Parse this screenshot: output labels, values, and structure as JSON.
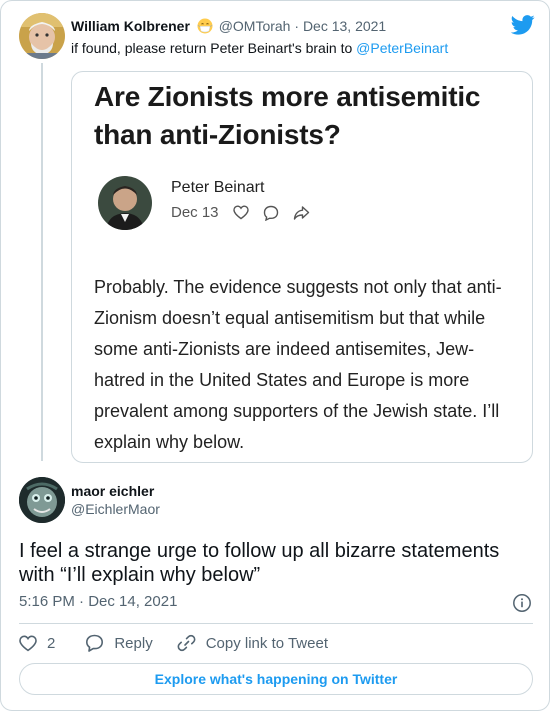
{
  "parent_tweet": {
    "display_name": "William Kolbrener",
    "emoji_icon": "face-with-medical-mask-emoji",
    "handle": "@OMTorah",
    "separator": "·",
    "date": "Dec 13, 2021",
    "text_prefix": "if found, please return Peter Beinart's brain to ",
    "mention": "@PeterBeinart"
  },
  "quoted_image": {
    "title": "Are Zionists more antisemitic than anti-Zionists?",
    "author": "Peter Beinart",
    "date": "Dec 13",
    "icons": [
      "heart-icon",
      "comment-icon",
      "share-icon"
    ],
    "body": "Probably. The evidence suggests not only that anti-Zionism doesn’t equal antisemitism but that while some anti-Zionists are indeed antisemites, Jew-hatred in the United States and Europe is more prevalent among supporters of the Jewish state. I’ll explain why below."
  },
  "reply_tweet": {
    "display_name": "maor eichler",
    "handle": "@EichlerMaor",
    "text": "I feel a strange urge to follow up all bizarre statements with “I’ll explain why below”",
    "timestamp": "5:16 PM · Dec 14, 2021"
  },
  "actions": {
    "like_count": "2",
    "reply_label": "Reply",
    "copy_link_label": "Copy link to Tweet"
  },
  "footer": {
    "explore_label": "Explore what's happening on Twitter"
  },
  "colors": {
    "accent": "#1d9bf0",
    "secondary_text": "#536471",
    "border": "#cfd9de"
  }
}
